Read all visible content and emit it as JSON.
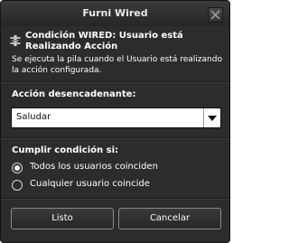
{
  "window": {
    "title": "Furni Wired"
  },
  "trigger": {
    "title": "Condición WIRED: Usuario está Realizando Acción",
    "description": "Se ejecuta la pila cuando el Usuario está realizando la acción configurada."
  },
  "action_trigger": {
    "label": "Acción desencadenante:",
    "selected": "Saludar"
  },
  "condition": {
    "label": "Cumplir condición si:",
    "options": [
      {
        "label": "Todos los usuarios coinciden",
        "selected": true
      },
      {
        "label": "Cualquier usuario coincide",
        "selected": false
      }
    ]
  },
  "buttons": {
    "ok": "Listo",
    "cancel": "Cancelar"
  },
  "icons": {
    "close": "close-icon",
    "trigger": "wired-condition-icon",
    "dropdown": "chevron-down-icon"
  }
}
